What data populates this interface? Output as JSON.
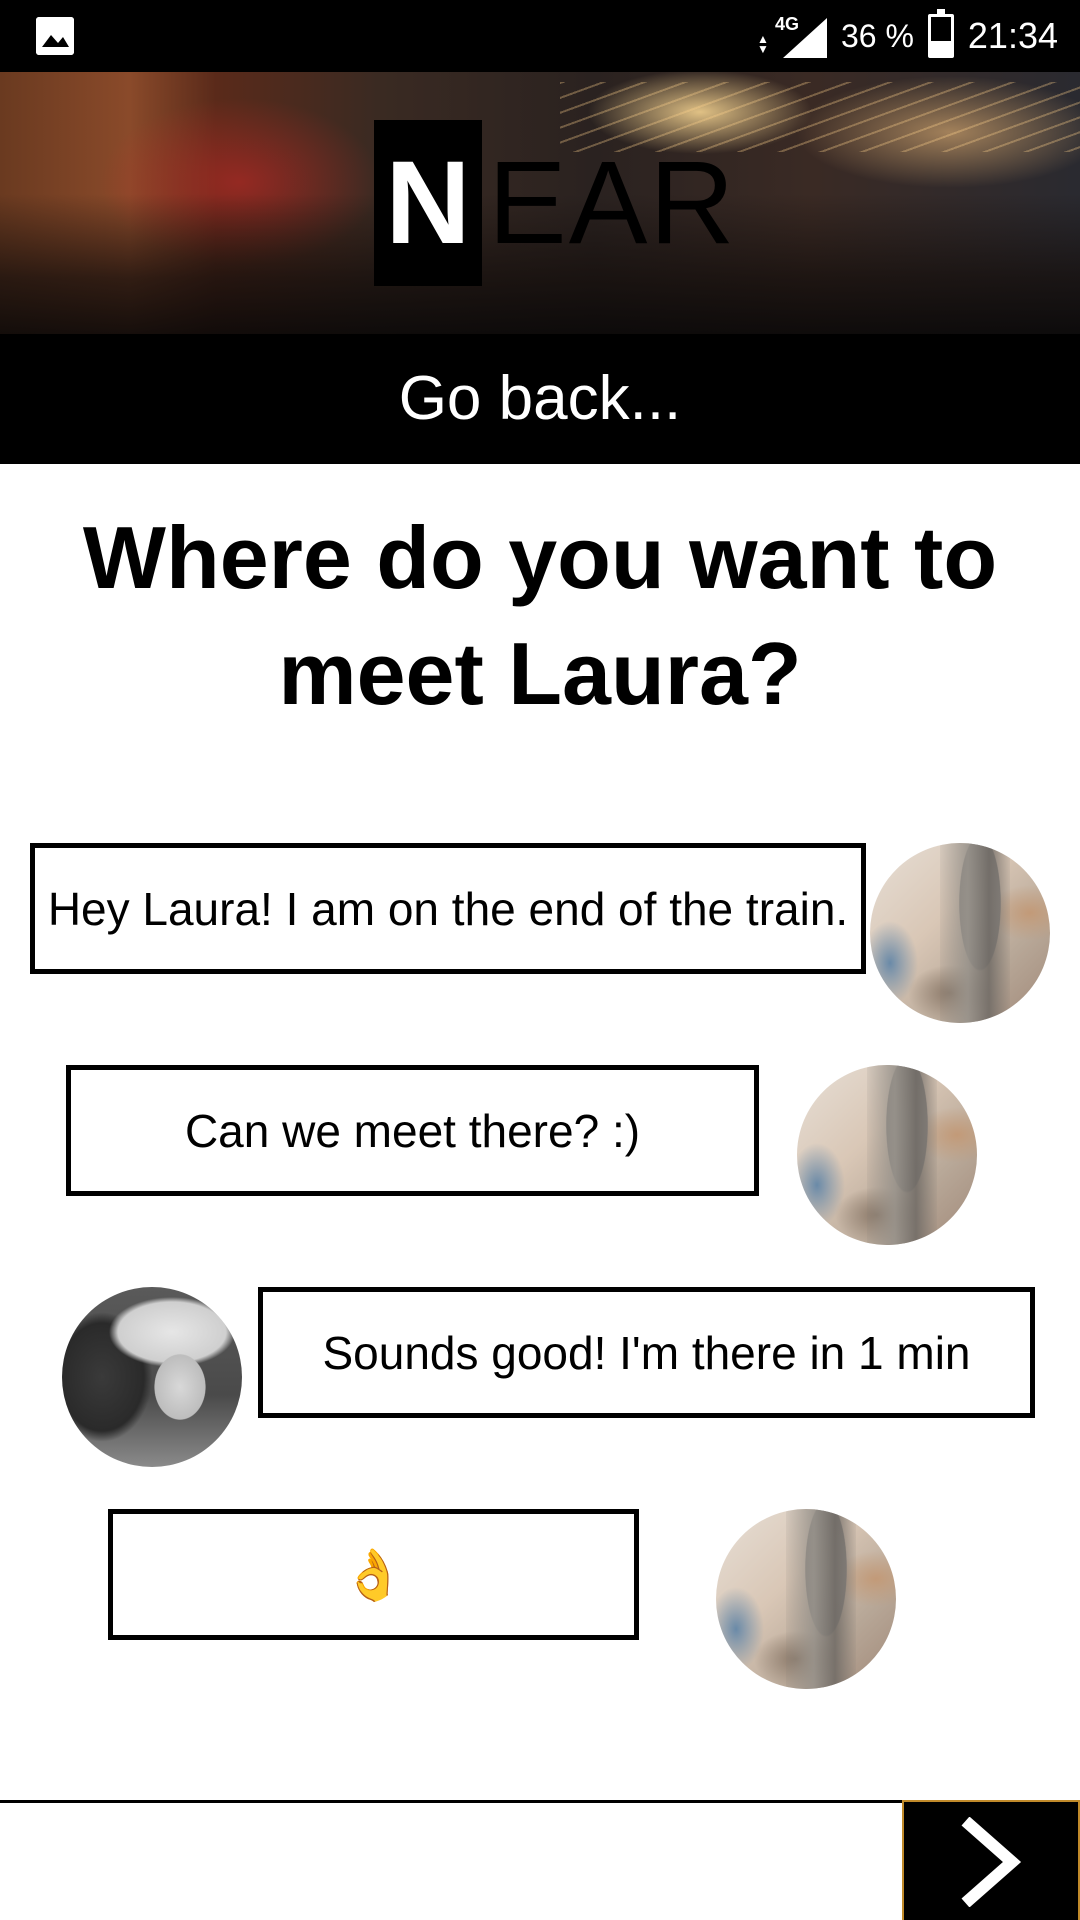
{
  "status_bar": {
    "network": "4G",
    "battery_percent": "36 %",
    "battery_level": 0.36,
    "time": "21:34",
    "icons": [
      "gallery-icon",
      "data-arrows-icon",
      "signal-icon",
      "battery-icon"
    ]
  },
  "banner": {
    "logo_first": "N",
    "logo_rest": "EAR"
  },
  "nav": {
    "go_back_label": "Go back..."
  },
  "page": {
    "title": "Where do you want to meet Laura?"
  },
  "messages": [
    {
      "text": "Hey Laura! I am on the end of the train.",
      "sender": "me"
    },
    {
      "text": "Can we meet there? :)",
      "sender": "me"
    },
    {
      "text": "Sounds good! I'm there in 1 min",
      "sender": "laura"
    },
    {
      "text": "👌",
      "sender": "me"
    }
  ],
  "composer": {
    "value": "",
    "placeholder": ""
  },
  "colors": {
    "background": "#ffffff",
    "primary": "#000000",
    "send_border": "#c08a2a"
  }
}
